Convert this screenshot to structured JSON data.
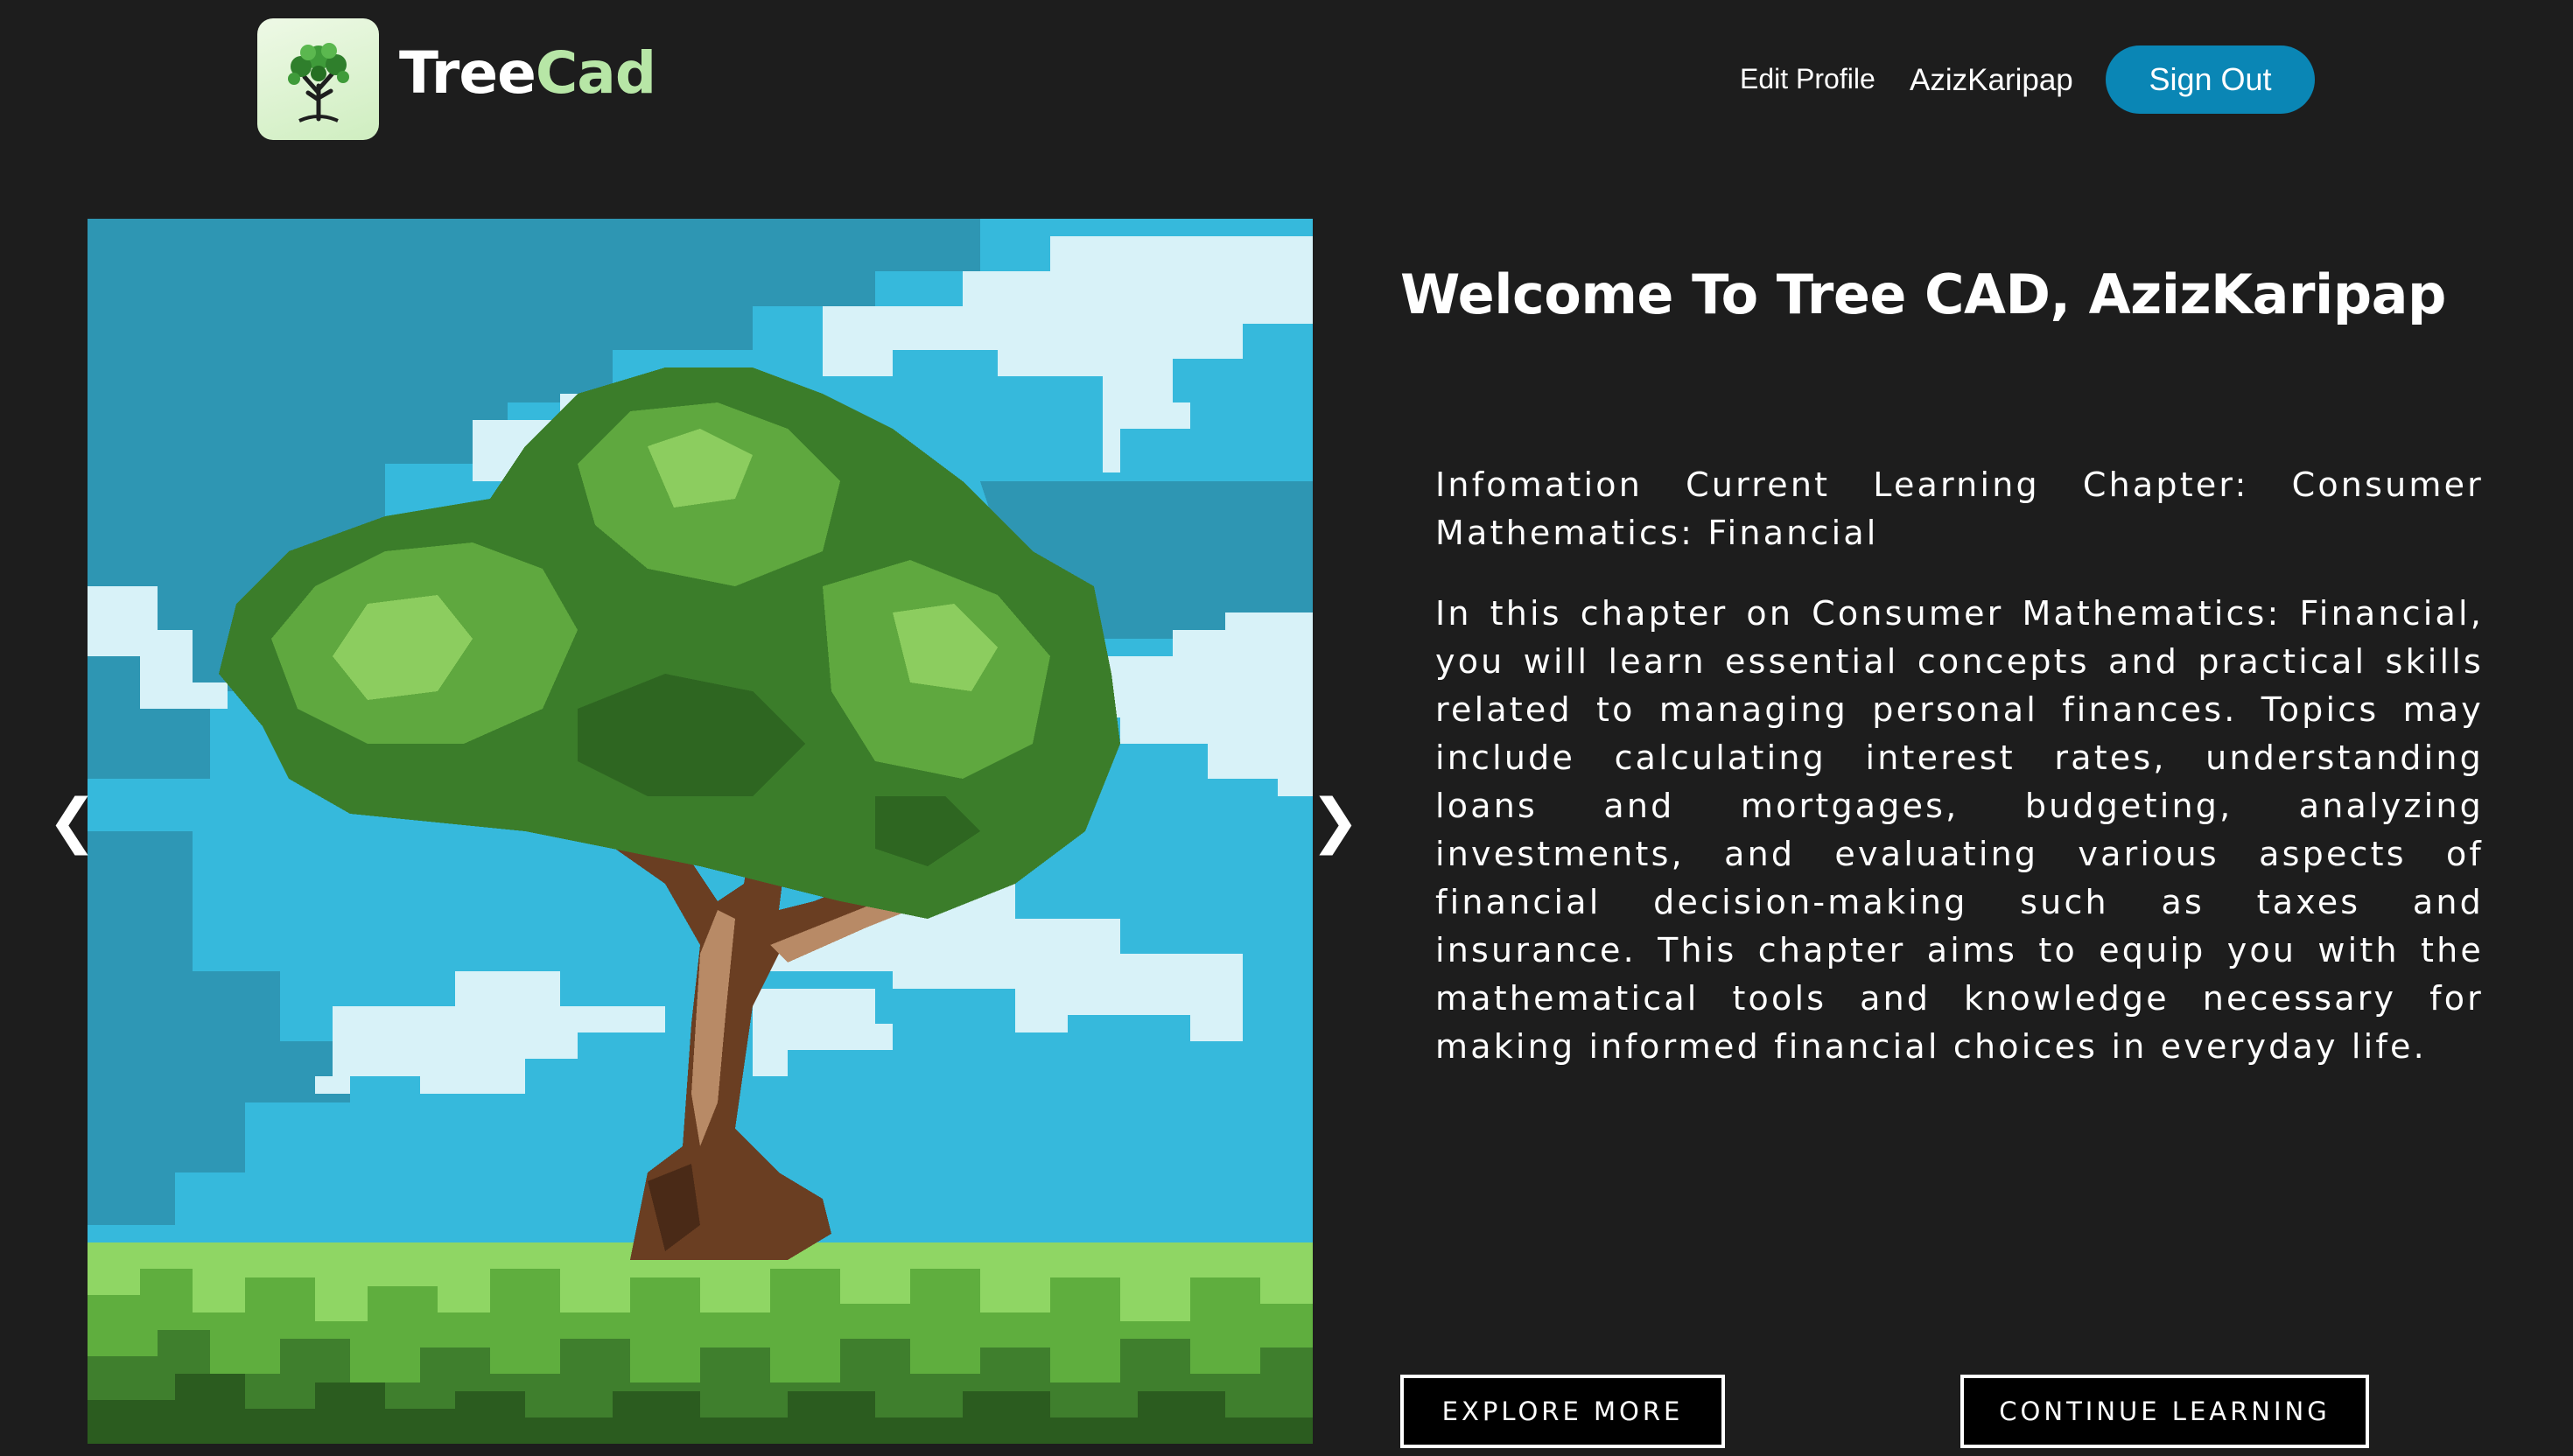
{
  "header": {
    "brand_part1": "Tree",
    "brand_part2": "Cad",
    "logo_icon": "tree-icon",
    "nav": {
      "edit_profile": "Edit Profile",
      "username": "AzizKaripap",
      "sign_out": "Sign Out"
    }
  },
  "carousel": {
    "prev_glyph": "❮",
    "next_glyph": "❯",
    "image_icon": "pixel-tree-illustration"
  },
  "main": {
    "welcome": "Welcome To Tree CAD, AzizKaripap",
    "info": "Infomation Current Learning Chapter: Consumer Mathematics: Financial",
    "description": "In this chapter on Consumer Mathematics: Financial, you will learn essential concepts and practical skills related to managing personal finances. Topics may include calculating interest rates, understanding loans and mortgages, budgeting, analyzing investments, and evaluating various aspects of financial decision-making such as taxes and insurance. This chapter aims to equip you with the mathematical tools and knowledge necessary for making informed financial choices in everyday life.",
    "explore_button": "EXPLORE MORE",
    "continue_button": "CONTINUE LEARNING"
  },
  "colors": {
    "background": "#1d1d1d",
    "accent": "#0a86b5",
    "brand_accent": "#b7e6a6"
  }
}
